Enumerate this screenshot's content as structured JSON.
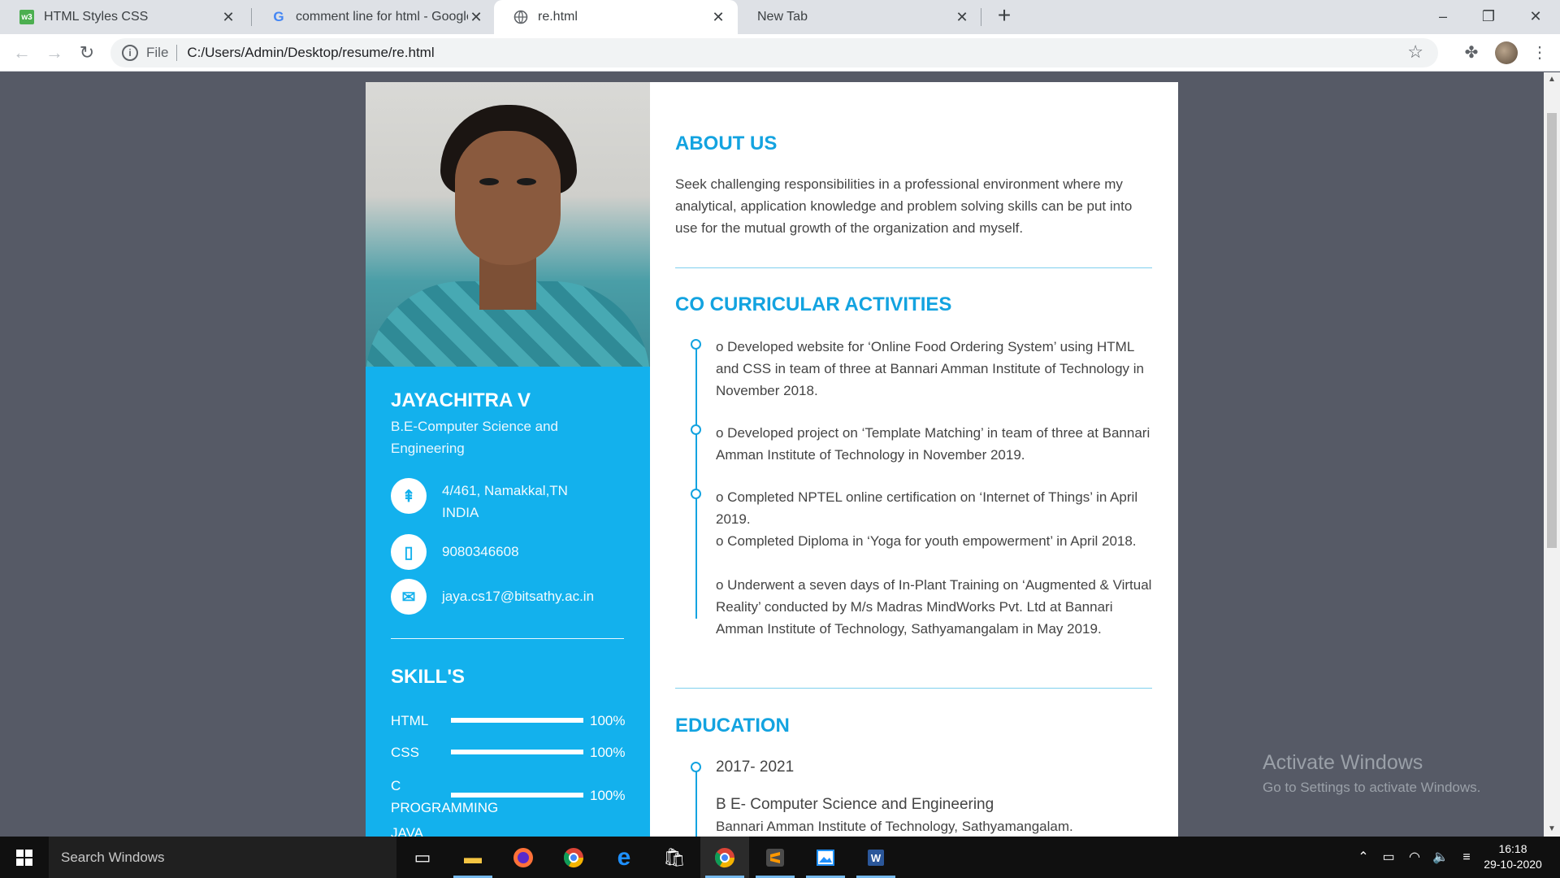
{
  "browser": {
    "tabs": [
      {
        "title": "HTML Styles CSS",
        "favicon": "w3schools-icon",
        "active": false
      },
      {
        "title": "comment line for html - Google S",
        "favicon": "google-icon",
        "active": false
      },
      {
        "title": "re.html",
        "favicon": "globe-icon",
        "active": true
      },
      {
        "title": "New Tab",
        "favicon": "",
        "active": false
      }
    ],
    "address": {
      "scheme": "File",
      "url": "C:/Users/Admin/Desktop/resume/re.html"
    }
  },
  "resume": {
    "name": "JAYACHITRA V",
    "degree": "B.E-Computer Science and Engineering",
    "contacts": [
      {
        "icon": "signpost-icon",
        "text": "4/461, Namakkal,TN INDIA"
      },
      {
        "icon": "mobile-icon",
        "text": "9080346608"
      },
      {
        "icon": "envelope-icon",
        "text": "jaya.cs17@bitsathy.ac.in"
      }
    ],
    "skills_heading": "SKILL'S",
    "skills": [
      {
        "label": "HTML",
        "percent": 100,
        "percent_label": "100%"
      },
      {
        "label": "CSS",
        "percent": 100,
        "percent_label": "100%"
      },
      {
        "label": "C PROGRAMMING",
        "percent": 100,
        "percent_label": "100%"
      },
      {
        "label": "JAVA",
        "percent": null,
        "percent_label": ""
      }
    ],
    "about": {
      "heading": "ABOUT US",
      "text": "Seek challenging responsibilities in a professional environment where my analytical, application knowledge and problem solving skills can be put into use for the mutual growth of the organization and myself."
    },
    "activities": {
      "heading": "CO CURRICULAR ACTIVITIES",
      "items": [
        "o Developed website for ‘Online Food Ordering System’ using HTML and CSS in team of three at Bannari Amman Institute of Technology in November 2018.",
        "o Developed project on ‘Template Matching’ in team of three at Bannari Amman Institute of Technology in November 2019.",
        "o Completed NPTEL online certification on ‘Internet of Things’ in April 2019.",
        "o Completed Diploma in ‘Yoga for youth empowerment’ in April 2018.",
        "o Underwent a seven days of In-Plant Training on ‘Augmented & Virtual Reality’ conducted by M/s Madras MindWorks Pvt. Ltd at Bannari Amman Institute of Technology, Sathyamangalam in May 2019."
      ]
    },
    "education": {
      "heading": "EDUCATION",
      "year": "2017- 2021",
      "degree": "B E- Computer Science and Engineering",
      "institute": "Bannari Amman Institute of Technology, Sathyamangalam."
    }
  },
  "watermark": {
    "line1": "Activate Windows",
    "line2": "Go to Settings to activate Windows."
  },
  "taskbar": {
    "search_placeholder": "Search Windows",
    "time": "16:18",
    "date": "29-10-2020"
  },
  "colors": {
    "accent": "#13b1ed",
    "heading": "#13a3e0",
    "page_bg": "#565a66"
  }
}
